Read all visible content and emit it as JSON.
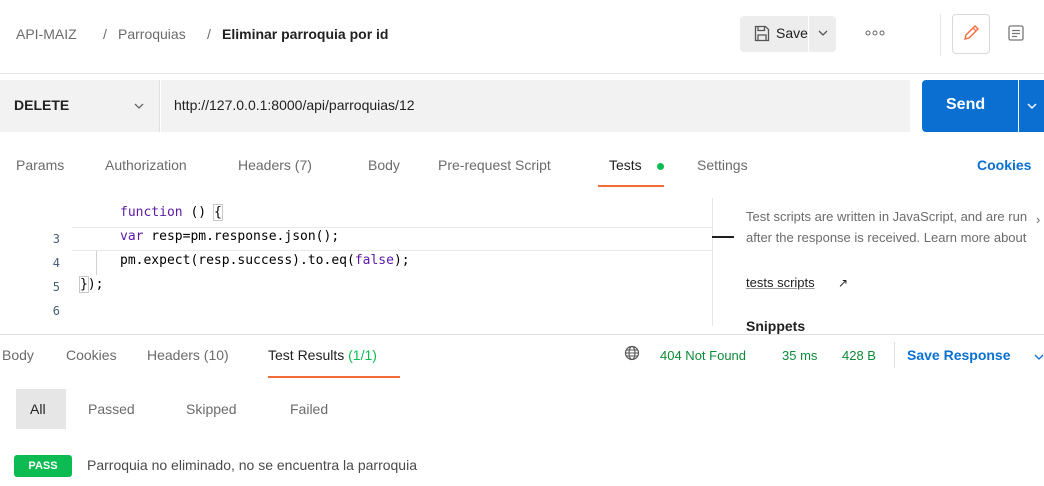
{
  "colors": {
    "accent_blue": "#0b6fd1",
    "tab_underline_orange": "#f26b3a",
    "success_green": "#0cbb52",
    "status_green": "#0e8a3a"
  },
  "header": {
    "breadcrumb": {
      "collection": "API-MAIZ",
      "separator": "/",
      "folder": "Parroquias",
      "request": "Eliminar parroquia por id"
    },
    "save_label": "Save",
    "icons": [
      "save-icon",
      "chevron-down-icon",
      "more-icon",
      "edit-icon",
      "docs-icon"
    ]
  },
  "request": {
    "method": "DELETE",
    "url": "http://127.0.0.1:8000/api/parroquias/12",
    "send_label": "Send"
  },
  "request_tabs": {
    "items": [
      {
        "label": "Params"
      },
      {
        "label": "Authorization"
      },
      {
        "label": "Headers (7)"
      },
      {
        "label": "Body"
      },
      {
        "label": "Pre-request Script"
      },
      {
        "label": "Tests",
        "active": true
      },
      {
        "label": "Settings"
      }
    ],
    "cookies_label": "Cookies"
  },
  "editor": {
    "lines": [
      {
        "number": "",
        "text": "function () {"
      },
      {
        "number": "3",
        "text": "var resp=pm.response.json();"
      },
      {
        "number": "4",
        "text": "pm.expect(resp.success).to.eq(false);"
      },
      {
        "number": "5",
        "text": "});"
      },
      {
        "number": "6",
        "text": ""
      }
    ]
  },
  "help": {
    "text": "Test scripts are written in JavaScript, and are run after the response is received. Learn more about",
    "link_label": "tests scripts",
    "link_arrow": "↗",
    "snippets_label": "Snippets",
    "close_glyph": "›"
  },
  "response_tabs": {
    "items": [
      {
        "label": "Body"
      },
      {
        "label": "Cookies"
      },
      {
        "label": "Headers (10)"
      },
      {
        "label": "Test Results",
        "count": "(1/1)",
        "active": true
      }
    ]
  },
  "response_status": {
    "status": "404 Not Found",
    "time": "35 ms",
    "size": "428 B",
    "save_response_label": "Save Response"
  },
  "filters": {
    "items": [
      {
        "label": "All",
        "active": true
      },
      {
        "label": "Passed"
      },
      {
        "label": "Skipped"
      },
      {
        "label": "Failed"
      }
    ]
  },
  "test_results": [
    {
      "status": "PASS",
      "name": "Parroquia no eliminado, no se encuentra la parroquia"
    }
  ]
}
